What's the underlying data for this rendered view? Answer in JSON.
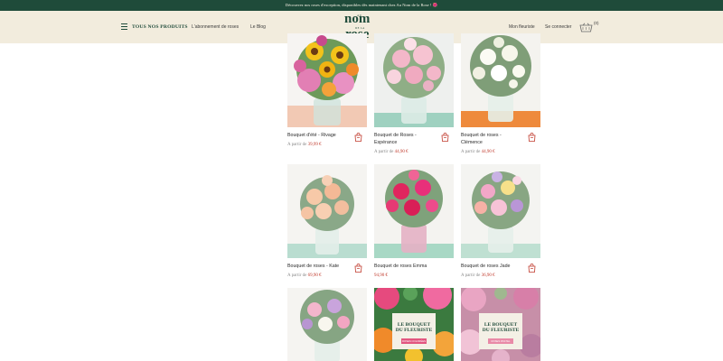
{
  "topbar": {
    "message": "Découvrez nos roses d'exception, disponibles dès maintenant chez Au Nom de la Rose ! 🌺"
  },
  "header": {
    "menu_label": "TOUS NOS PRODUITS",
    "nav": [
      "L'abonnement de roses",
      "Le Blog"
    ],
    "logo": {
      "au": "AU",
      "nom": "nom",
      "dela": "DE LA",
      "rose": "rose"
    },
    "account": [
      "Mon fleuriste",
      "Se connecter"
    ],
    "cart_count": "(0)"
  },
  "colors": {
    "brand_green": "#1f4b3a",
    "header_bg": "#f2ecdd",
    "price_red": "#c0392b"
  },
  "products": [
    {
      "title": "Bouquet d'été - Rivage",
      "prefix": "A partir de",
      "price": "39,99 €"
    },
    {
      "title": "Bouquet de Roses - Espérance",
      "prefix": "A partir de",
      "price": "44,90 €"
    },
    {
      "title": "Bouquet de roses - Clémence",
      "prefix": "A partir de",
      "price": "44,90 €"
    },
    {
      "title": "Bouquet de roses - Kate",
      "prefix": "A partir de",
      "price": "69,90 €"
    },
    {
      "title": "Bouquet de roses Emma",
      "prefix": "",
      "price": "94,90 €"
    },
    {
      "title": "Bouquet de roses Jade",
      "prefix": "A partir de",
      "price": "36,90 €"
    },
    {
      "title": "",
      "prefix": "",
      "price": ""
    },
    {
      "title": "",
      "prefix": "",
      "price": "",
      "overlay": [
        "LE BOUQUET",
        "DU FLEURISTE"
      ],
      "tag": "ROSES COLORÉES"
    },
    {
      "title": "",
      "prefix": "",
      "price": "",
      "overlay": [
        "LE BOUQUET",
        "DU FLEURISTE"
      ],
      "tag": "ROSES PASTEL"
    }
  ]
}
